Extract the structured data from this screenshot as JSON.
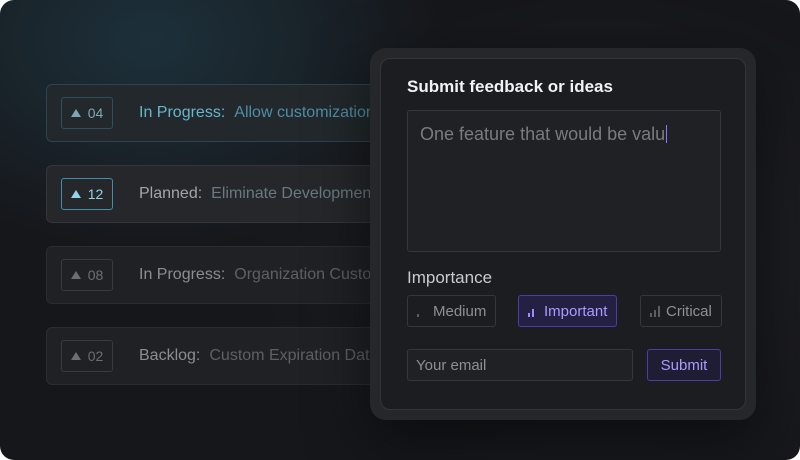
{
  "backlog": [
    {
      "votes": "04",
      "status": "In Progress:",
      "title": "Allow customization"
    },
    {
      "votes": "12",
      "status": "Planned:",
      "title": "Eliminate Development"
    },
    {
      "votes": "08",
      "status": "In Progress:",
      "title": "Organization Custom"
    },
    {
      "votes": "02",
      "status": "Backlog:",
      "title": "Custom Expiration Date"
    }
  ],
  "feedback": {
    "title": "Submit feedback or ideas",
    "text_value": "One feature that would be valu",
    "importance_label": "Importance",
    "options": [
      {
        "label": "Medium",
        "level": 1
      },
      {
        "label": "Important",
        "level": 2,
        "selected": true
      },
      {
        "label": "Critical",
        "level": 3
      }
    ],
    "email_placeholder": "Your email",
    "submit_label": "Submit"
  },
  "colors": {
    "accent_cyan": "#68b5d0",
    "accent_purple": "#a99bff",
    "background": "#16171b"
  },
  "icons": {
    "vote": "upvote-triangle-icon",
    "importance": "signal-bars-icon"
  }
}
